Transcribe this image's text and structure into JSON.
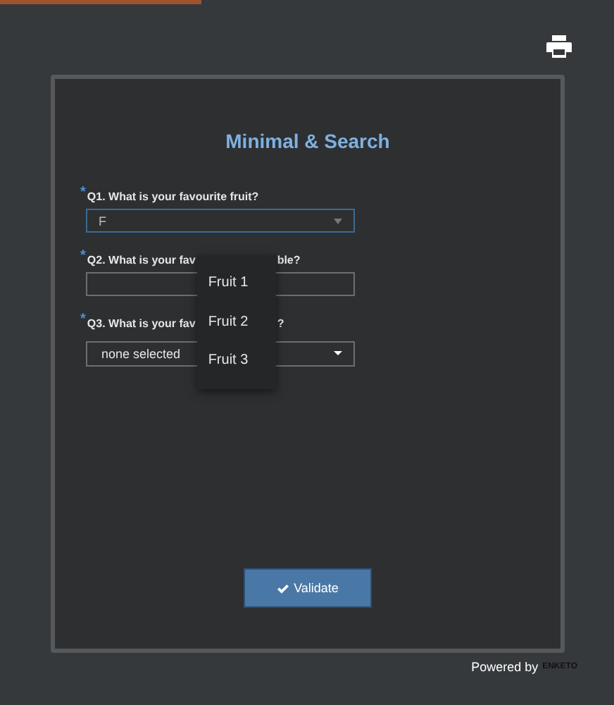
{
  "form": {
    "title": "Minimal & Search",
    "questions": [
      {
        "kind": "search",
        "required": true,
        "required_mark": "*",
        "label_parts": [
          "Q1. What is your favourite fruit?"
        ],
        "value": "F",
        "focused": true
      },
      {
        "kind": "text",
        "required": true,
        "required_mark": "*",
        "label_parts": [
          "Q2. What is your fav",
          "ble?"
        ],
        "focused": false
      },
      {
        "kind": "select",
        "required": true,
        "required_mark": "*",
        "label_parts": [
          "Q3. What is your fav",
          "?"
        ],
        "value": "none selected",
        "focused": false
      }
    ],
    "dropdown": {
      "options": [
        "Fruit 1",
        "Fruit 2",
        "Fruit 3"
      ]
    },
    "submit": "Validate"
  },
  "footer": {
    "text": "Powered by",
    "brand": "ENKETO"
  }
}
